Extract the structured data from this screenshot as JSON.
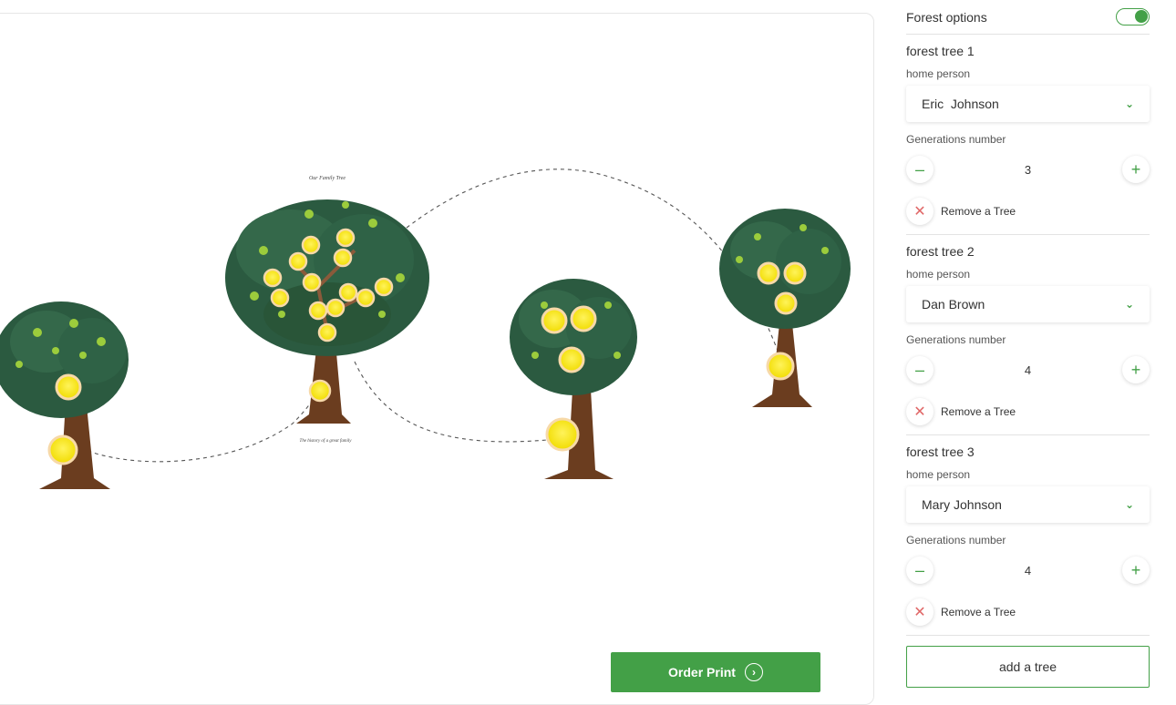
{
  "canvas": {
    "title": "Our Family Tree",
    "subtitle": "The history of a great family"
  },
  "order_button": {
    "label": "Order Print"
  },
  "panel": {
    "forest_options_label": "Forest options",
    "forest_options_enabled": true,
    "trees": [
      {
        "title": "forest tree 1",
        "home_person_label": "home person",
        "home_person": "Eric  Johnson",
        "generations_label": "Generations number",
        "generations": "3",
        "remove_label": "Remove a Tree"
      },
      {
        "title": "forest tree 2",
        "home_person_label": "home person",
        "home_person": "Dan Brown",
        "generations_label": "Generations number",
        "generations": "4",
        "remove_label": "Remove a Tree"
      },
      {
        "title": "forest tree 3",
        "home_person_label": "home person",
        "home_person": "Mary Johnson",
        "generations_label": "Generations number",
        "generations": "4",
        "remove_label": "Remove a Tree"
      }
    ],
    "add_tree_label": "add a tree"
  },
  "icons": {
    "chevron": "chevron-down-icon",
    "minus": "minus-icon",
    "plus": "plus-icon",
    "remove": "close-icon",
    "order": "chevron-right-circle-icon"
  },
  "colors": {
    "accent": "#43a047",
    "remove": "#e06767",
    "foliage_dark": "#2b5a40",
    "foliage_light": "#9ccc3c",
    "trunk": "#6b3d1f",
    "medallion": "#f5e60f"
  }
}
